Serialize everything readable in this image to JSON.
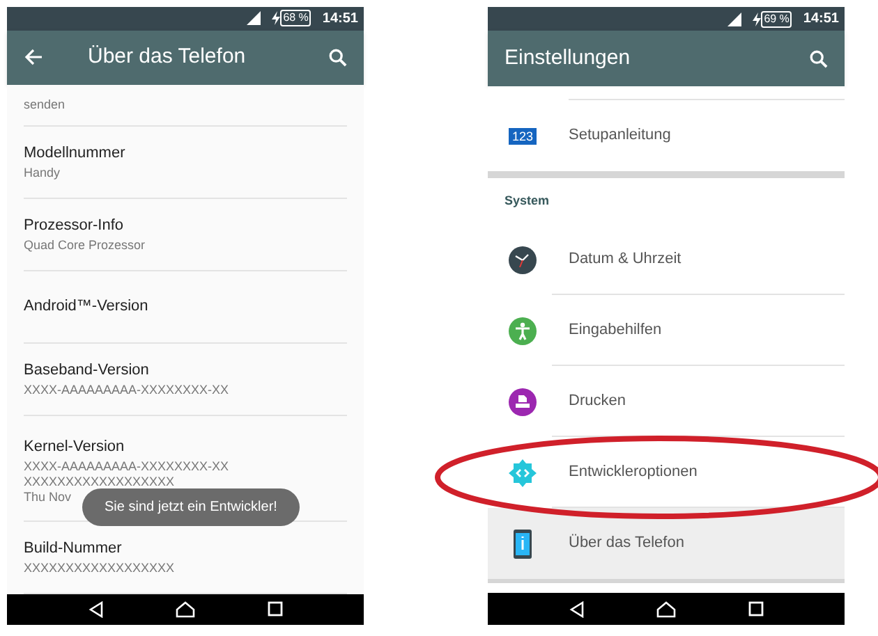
{
  "phones": [
    {
      "status_bar": {
        "battery": "68 %",
        "time": "14:51"
      },
      "app_bar": {
        "title": "Über das Telefon",
        "back": true
      },
      "kind": "about",
      "items": [
        {
          "lines": [
            "senden"
          ]
        },
        {
          "title": "Modellnummer",
          "lines": [
            "Handy"
          ]
        },
        {
          "title": "Prozessor-Info",
          "lines": [
            "Quad Core Prozessor"
          ]
        },
        {
          "title": "Android™-Version"
        },
        {
          "title": "Baseband-Version",
          "lines": [
            "XXXX-AAAAAAAAA-XXXXXXXX-XX"
          ]
        },
        {
          "title": "Kernel-Version",
          "lines": [
            "XXXX-AAAAAAAAA-XXXXXXXX-XX",
            "XXXXXXXXXXXXXXXXXX",
            "Thu Nov"
          ]
        },
        {
          "title": "Build-Nummer",
          "lines": [
            "XXXXXXXXXXXXXXXXXX"
          ]
        }
      ],
      "toast": "Sie sind jetzt ein Entwickler!"
    },
    {
      "status_bar": {
        "battery": "69 %",
        "time": "14:51"
      },
      "app_bar": {
        "title": "Einstellungen",
        "back": false
      },
      "kind": "settings",
      "items": [
        {
          "kind": "numbers",
          "icon_text": "123",
          "label": "Setupanleitung",
          "selected": false
        },
        {
          "kind": "header",
          "label": "System"
        },
        {
          "kind": "clock",
          "label": "Datum & Uhrzeit",
          "selected": false
        },
        {
          "kind": "person",
          "label": "Eingabehilfen",
          "selected": false
        },
        {
          "kind": "printer",
          "label": "Drucken",
          "selected": false
        },
        {
          "kind": "gear",
          "label": "Entwickleroptionen",
          "selected": false
        },
        {
          "kind": "phone",
          "label": "Über das Telefon",
          "selected": true
        }
      ]
    }
  ],
  "highlight_ellipse": true
}
